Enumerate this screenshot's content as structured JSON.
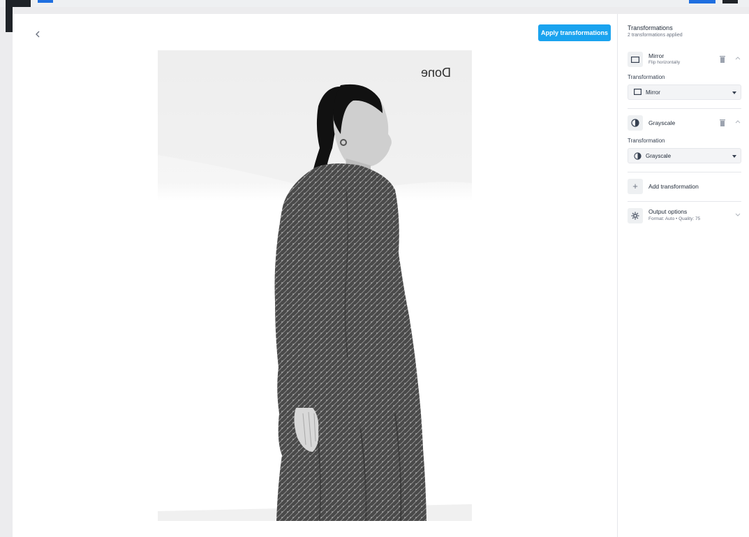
{
  "header": {
    "back_icon": "chevron-left-icon",
    "apply_label": "Apply transformations"
  },
  "preview": {
    "image_text": "Done"
  },
  "panel": {
    "title": "Transformations",
    "subtitle": "2 transformations applied",
    "transformations": [
      {
        "name": "Mirror",
        "description": "Flip horizontally",
        "icon": "mirror-icon",
        "field_label": "Transformation",
        "selected": "Mirror"
      },
      {
        "name": "Grayscale",
        "description": "",
        "icon": "grayscale-icon",
        "field_label": "Transformation",
        "selected": "Grayscale"
      }
    ],
    "add_label": "Add transformation",
    "output": {
      "title": "Output options",
      "subtitle": "Format: Auto • Quality: 75"
    }
  },
  "colors": {
    "accent": "#1aa3ef",
    "topbar_blue": "#1f6fe0",
    "dark": "#1f2328"
  }
}
